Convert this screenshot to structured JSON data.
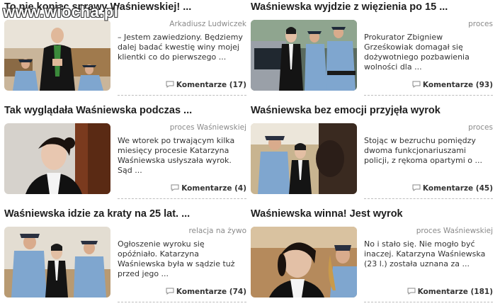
{
  "watermark": "www.wiocha.pl",
  "articles": [
    {
      "title": "To nie koniec sprawy Waśniewskiej! ...",
      "meta": "Arkadiusz Ludwiczek",
      "excerpt": "– Jestem zawiedziony. Będziemy dalej badać kwestię winy mojej klientki co do pierwszego ...",
      "comments": "Komentarze (17)"
    },
    {
      "title": "Waśniewska wyjdzie z więzienia po 15 ...",
      "meta": "proces",
      "excerpt": "Prokurator Zbigniew Grześkowiak domagał się dożywotniego pozbawienia wolności dla ...",
      "comments": "Komentarze (93)"
    },
    {
      "title": "Tak wyglądała Waśniewska podczas ...",
      "meta": "proces Waśniewskiej",
      "excerpt": "We wtorek po trwającym kilka miesięcy procesie Katarzyna Waśniewska usłyszała wyrok. Sąd ...",
      "comments": "Komentarze (4)"
    },
    {
      "title": "Waśniewska bez emocji przyjęła wyrok",
      "meta": "proces",
      "excerpt": "Stojąc w bezruchu pomiędzy dwoma funkcjonariuszami policji, z rękoma opartymi o ...",
      "comments": "Komentarze (45)"
    },
    {
      "title": "Waśniewska idzie za kraty na 25 lat. ...",
      "meta": "relacja na żywo",
      "excerpt": "Ogłoszenie wyroku się opóźniało. Katarzyna Waśniewska była w sądzie tuż przed jego ...",
      "comments": "Komentarze (74)"
    },
    {
      "title": "Waśniewska winna! Jest wyrok",
      "meta": "proces Waśniewskiej",
      "excerpt": "No i stało się. Nie mogło być inaczej. Katarzyna Waśniewska (23 l.) została uznana za ...",
      "comments": "Komentarze (181)"
    }
  ],
  "colors": {
    "title": "#1e1e1e",
    "meta": "#8a8a8a",
    "police_uniform": "#7fa6cf",
    "cap": "#1f2a3a"
  }
}
